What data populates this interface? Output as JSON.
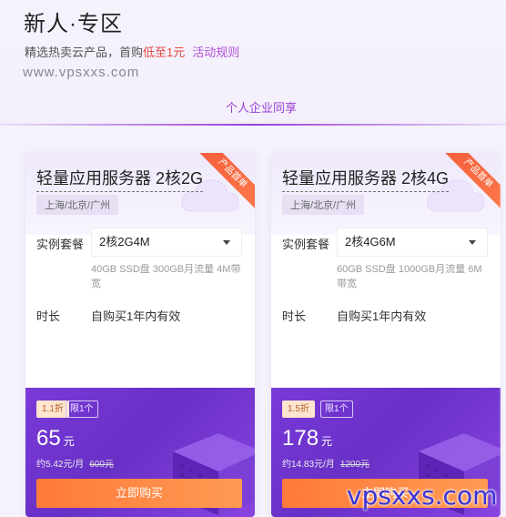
{
  "header": {
    "title": "新人·专区",
    "subtitle_prefix": "精选热卖云产品，首购",
    "subtitle_highlight": "低至1元",
    "rules_link": "活动规则",
    "watermark": "www.vpsxxs.com",
    "tab": "个人企业同享"
  },
  "colors": {
    "accent_purple": "#9b3ed6",
    "highlight_red": "#e2463a",
    "button_orange": "#ff7a3a",
    "ribbon": "#f25b3a"
  },
  "cards": [
    {
      "ribbon": "产品首单",
      "title": "轻量应用服务器 2核2G",
      "location": "上海/北京/广州",
      "package_label": "实例套餐",
      "package_value": "2核2G4M",
      "spec": "40GB SSD盘 300GB月流量 4M带宽",
      "duration_label": "时长",
      "duration_value": "自购买1年内有效",
      "discount": "1.1折",
      "limit": "限1个",
      "price": "65",
      "price_unit": "元",
      "monthly": "约5.42元/月",
      "original_price": "600元",
      "buy_label": "立即购买"
    },
    {
      "ribbon": "产品首单",
      "title": "轻量应用服务器 2核4G",
      "location": "上海/北京/广州",
      "package_label": "实例套餐",
      "package_value": "2核4G6M",
      "spec": "60GB SSD盘 1000GB月流量 6M带宽",
      "duration_label": "时长",
      "duration_value": "自购买1年内有效",
      "discount": "1.5折",
      "limit": "限1个",
      "price": "178",
      "price_unit": "元",
      "monthly": "约14.83元/月",
      "original_price": "1200元",
      "buy_label": "立即购买"
    }
  ],
  "footer_watermark": "vpsxxs.com",
  "icons": [
    "chevron-down-icon",
    "cloud-icon",
    "server-cube-icon"
  ]
}
